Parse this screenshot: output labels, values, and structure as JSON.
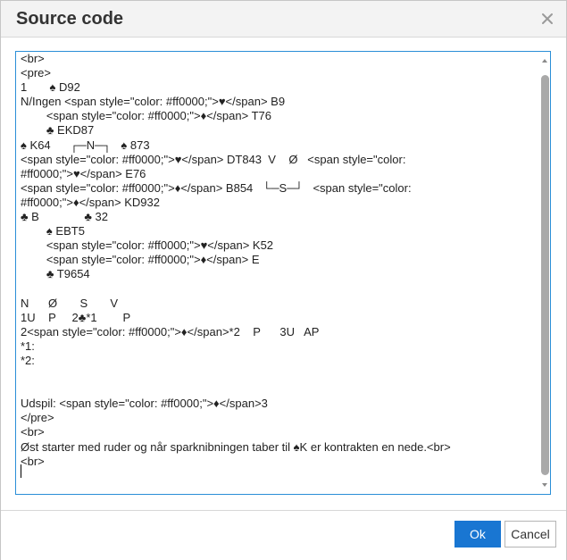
{
  "dialog": {
    "title": "Source code",
    "ok_label": "Ok",
    "cancel_label": "Cancel"
  },
  "editor": {
    "lines": [
      "<br>",
      "<pre>",
      "1       ♠ D92",
      "N/Ingen <span style=\"color: #ff0000;\">♥</span> B9",
      "        <span style=\"color: #ff0000;\">♦</span> T76",
      "        ♣ EKD87",
      "♠ K64      ┌─N─┐   ♠ 873",
      "<span style=\"color: #ff0000;\">♥</span> DT843  V    Ø   <span style=\"color:",
      "#ff0000;\">♥</span> E76",
      "<span style=\"color: #ff0000;\">♦</span> B854   └─S─┘   <span style=\"color:",
      "#ff0000;\">♦</span> KD932",
      "♣ B              ♣ 32",
      "        ♠ EBT5",
      "        <span style=\"color: #ff0000;\">♥</span> K52",
      "        <span style=\"color: #ff0000;\">♦</span> E",
      "        ♣ T9654",
      "",
      "N      Ø       S       V",
      "1U    P     2♣*1        P",
      "2<span style=\"color: #ff0000;\">♦</span>*2    P      3U   AP",
      "*1:",
      "*2:",
      "",
      "",
      "Udspil: <span style=\"color: #ff0000;\">♦</span>3",
      "</pre>",
      "<br>",
      "Øst starter med ruder og når sparknibningen taber til ♠K er kontrakten en nede.<br>",
      "<br>"
    ]
  },
  "icons": {
    "close": "close-icon",
    "scroll_up": "arrow-up-icon",
    "scroll_down": "arrow-down-icon"
  },
  "colors": {
    "accent": "#1976d2",
    "editor_border": "#2a8ed7",
    "header_bg": "#f3f3f3"
  }
}
